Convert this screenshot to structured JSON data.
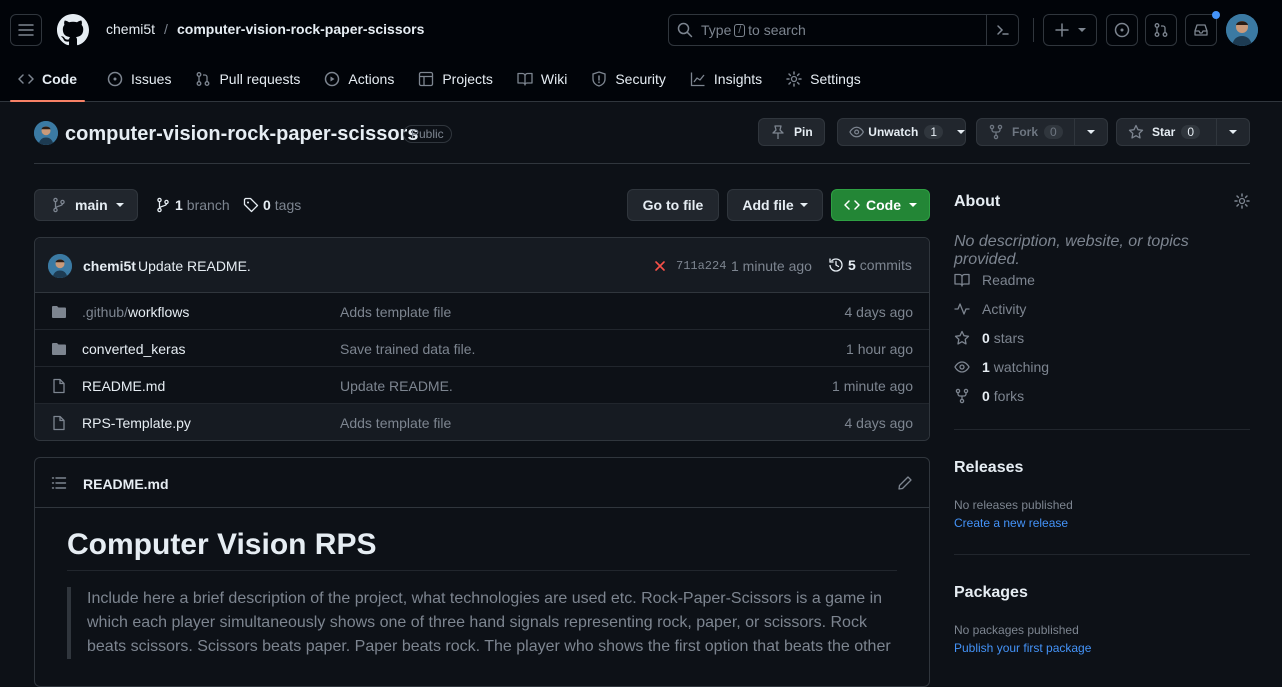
{
  "header": {
    "owner": "chemi5t",
    "separator": "/",
    "repo": "computer-vision-rock-paper-scissors",
    "search_prefix": "Type",
    "search_key": "/",
    "search_suffix": "to search"
  },
  "tabs": [
    {
      "label": "Code",
      "icon": "code-icon"
    },
    {
      "label": "Issues",
      "icon": "issue-icon"
    },
    {
      "label": "Pull requests",
      "icon": "pull-request-icon"
    },
    {
      "label": "Actions",
      "icon": "play-icon"
    },
    {
      "label": "Projects",
      "icon": "table-icon"
    },
    {
      "label": "Wiki",
      "icon": "book-icon"
    },
    {
      "label": "Security",
      "icon": "shield-icon"
    },
    {
      "label": "Insights",
      "icon": "graph-icon"
    },
    {
      "label": "Settings",
      "icon": "gear-icon"
    }
  ],
  "repo_header": {
    "name": "computer-vision-rock-paper-scissors",
    "visibility": "Public",
    "pin_label": "Pin",
    "watch_label": "Unwatch",
    "watch_count": "1",
    "fork_label": "Fork",
    "fork_count": "0",
    "star_label": "Star",
    "star_count": "0"
  },
  "toolbar": {
    "branch": "main",
    "branch_count": "1",
    "branch_word": "branch",
    "tag_count": "0",
    "tag_word": "tags",
    "go_to_file": "Go to file",
    "add_file": "Add file",
    "code": "Code"
  },
  "commit": {
    "author": "chemi5t",
    "message": "Update README.",
    "sha": "711a224",
    "age": "1 minute ago",
    "commit_count": "5",
    "commit_word": "commits"
  },
  "files": [
    {
      "prefix": ".github/",
      "name": "workflows",
      "type": "folder",
      "message": "Adds template file",
      "age": "4 days ago"
    },
    {
      "prefix": "",
      "name": "converted_keras",
      "type": "folder",
      "message": "Save trained data file.",
      "age": "1 hour ago"
    },
    {
      "prefix": "",
      "name": "README.md",
      "type": "file",
      "message": "Update README.",
      "age": "1 minute ago"
    },
    {
      "prefix": "",
      "name": "RPS-Template.py",
      "type": "file",
      "message": "Adds template file",
      "age": "4 days ago"
    }
  ],
  "readme": {
    "filename": "README.md",
    "heading": "Computer Vision RPS",
    "quote_lines": [
      "Include here a brief description of the project, what technologies are used etc. Rock-Paper-Scissors is a game in",
      "which each player simultaneously shows one of three hand signals representing rock, paper, or scissors. Rock",
      "beats scissors. Scissors beats paper. Paper beats rock. The player who shows the first option that beats the other"
    ]
  },
  "about": {
    "title": "About",
    "description": "No description, website, or topics provided.",
    "items": [
      {
        "icon": "book-icon",
        "count": "",
        "label": "Readme"
      },
      {
        "icon": "pulse-icon",
        "count": "",
        "label": "Activity"
      },
      {
        "icon": "star-icon",
        "count": "0",
        "label": "stars"
      },
      {
        "icon": "eye-icon",
        "count": "1",
        "label": "watching"
      },
      {
        "icon": "fork-icon",
        "count": "0",
        "label": "forks"
      }
    ]
  },
  "releases": {
    "title": "Releases",
    "empty": "No releases published",
    "link": "Create a new release"
  },
  "packages": {
    "title": "Packages",
    "empty": "No packages published",
    "link": "Publish your first package"
  },
  "colors": {
    "background": "#0d1117",
    "header_bg": "#010409",
    "accent_tab": "#f78166",
    "code_button": "#238636",
    "link": "#4493f8",
    "fail": "#f85149"
  }
}
